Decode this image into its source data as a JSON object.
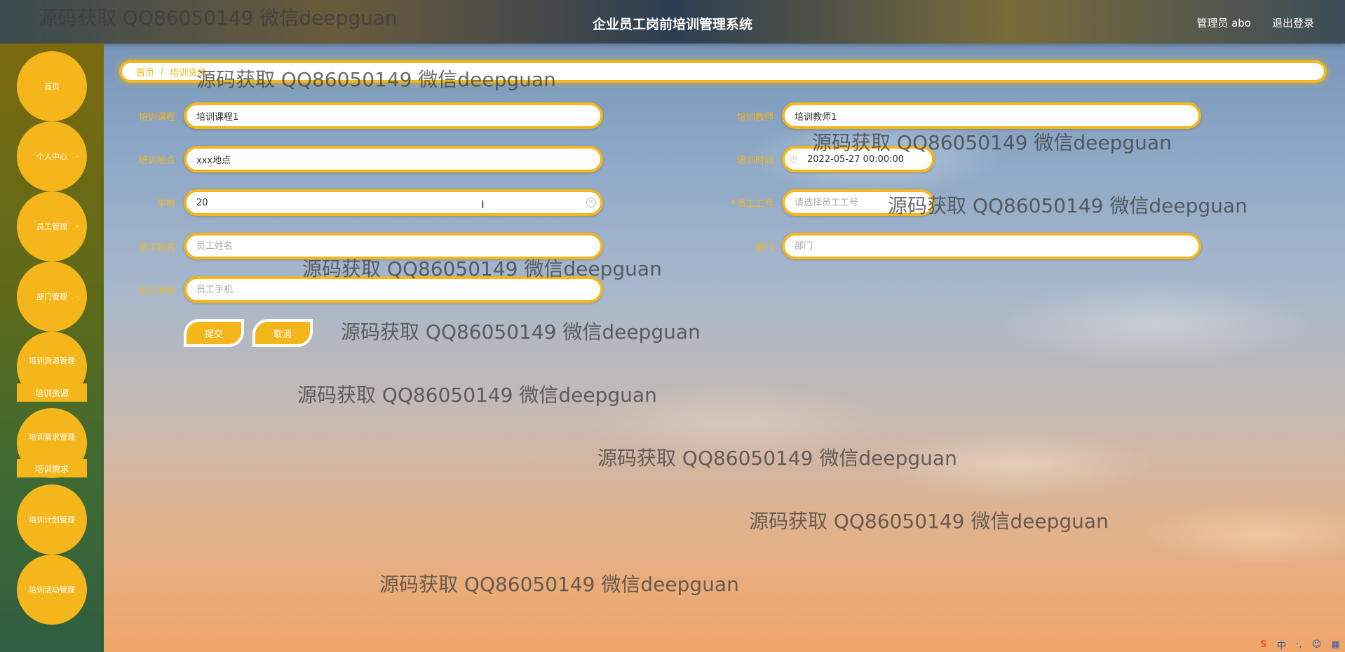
{
  "header": {
    "title": "企业员工岗前培训管理系统",
    "user": "管理员 abo",
    "logout": "退出登录"
  },
  "sidebar": {
    "items": [
      {
        "label": "首页"
      },
      {
        "label": "个人中心"
      },
      {
        "label": "员工管理"
      },
      {
        "label": "部门管理"
      },
      {
        "label": "培训资源管理"
      },
      {
        "label": "培训资源"
      },
      {
        "label": "培训需求管理"
      },
      {
        "label": "培训需求"
      },
      {
        "label": "培训计划管理"
      },
      {
        "label": "培训活动管理"
      }
    ]
  },
  "breadcrumb": {
    "home": "首页",
    "separator": "/",
    "current": "培训资源"
  },
  "form": {
    "course": {
      "label": "培训课程",
      "value": "培训课程1"
    },
    "teacher": {
      "label": "培训教师",
      "value": "培训教师1"
    },
    "location": {
      "label": "培训地点",
      "value": "xxx地点"
    },
    "time": {
      "label": "培训时间",
      "value": "2022-05-27 00:00:00"
    },
    "hours": {
      "label": "学时",
      "value": "20"
    },
    "employee_id": {
      "label": "员工工号",
      "placeholder": "请选择员工工号"
    },
    "employee_name": {
      "label": "员工姓名",
      "placeholder": "员工姓名"
    },
    "department": {
      "label": "部门",
      "placeholder": "部门"
    },
    "employee_phone": {
      "label": "员工手机",
      "placeholder": "员工手机"
    }
  },
  "buttons": {
    "submit": "提交",
    "cancel": "取消"
  },
  "watermark": "源码获取 QQ86050149 微信deepguan",
  "ime": {
    "logo": "S",
    "lang": "中",
    "dot": "·,",
    "emoji": "☺",
    "kbd": "▦"
  },
  "colors": {
    "accent": "#f4b61b"
  }
}
